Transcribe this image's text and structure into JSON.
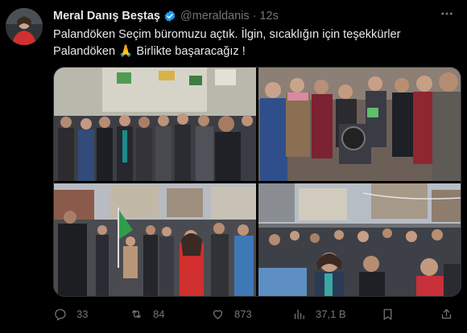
{
  "tweet": {
    "author_name": "Meral Danış Beştaş",
    "handle": "@meraldanis",
    "separator": "·",
    "time": "12s",
    "text_line1": "Palandöken Seçim büromuzu açtık. İlgin, sıcaklığın için teşekkürler",
    "text_line2": "Palandöken 🙏 Birlikte başaracağız !",
    "verified_color": "#1d9bf0",
    "accent_red": "#e0242b"
  },
  "actions": {
    "replies": "33",
    "reposts": "84",
    "likes": "873",
    "views": "37,1 B"
  },
  "icons": {
    "reply": "reply-icon",
    "repost": "repost-icon",
    "like": "heart-icon",
    "views": "bar-chart-icon",
    "bookmark": "bookmark-icon",
    "share": "share-icon",
    "more": "more-icon",
    "verified": "verified-badge-icon"
  }
}
